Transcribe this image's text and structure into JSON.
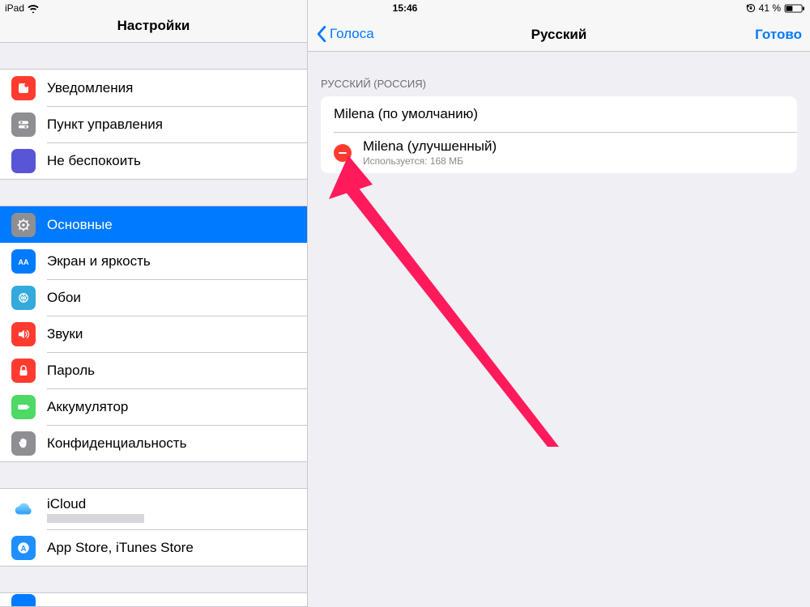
{
  "statusbar": {
    "device": "iPad",
    "time": "15:46",
    "battery_text": "41 %"
  },
  "sidebar": {
    "title": "Настройки",
    "group1": [
      {
        "key": "notifications",
        "label": "Уведомления"
      },
      {
        "key": "control-center",
        "label": "Пункт управления"
      },
      {
        "key": "dnd",
        "label": "Не беспокоить"
      }
    ],
    "group2": [
      {
        "key": "general",
        "label": "Основные"
      },
      {
        "key": "display",
        "label": "Экран и яркость"
      },
      {
        "key": "wallpaper",
        "label": "Обои"
      },
      {
        "key": "sounds",
        "label": "Звуки"
      },
      {
        "key": "passcode",
        "label": "Пароль"
      },
      {
        "key": "battery",
        "label": "Аккумулятор"
      },
      {
        "key": "privacy",
        "label": "Конфиденциальность"
      }
    ],
    "group3": [
      {
        "key": "icloud",
        "label": "iCloud"
      },
      {
        "key": "appstore",
        "label": "App Store, iTunes Store"
      }
    ]
  },
  "main": {
    "back_label": "Голоса",
    "title": "Русский",
    "done_label": "Готово",
    "section_header": "РУССКИЙ (РОССИЯ)",
    "voices": [
      {
        "title": "Milena (по умолчанию)",
        "deletable": false
      },
      {
        "title": "Milena (улучшенный)",
        "subtitle": "Используется: 168 МБ",
        "deletable": true
      }
    ]
  }
}
